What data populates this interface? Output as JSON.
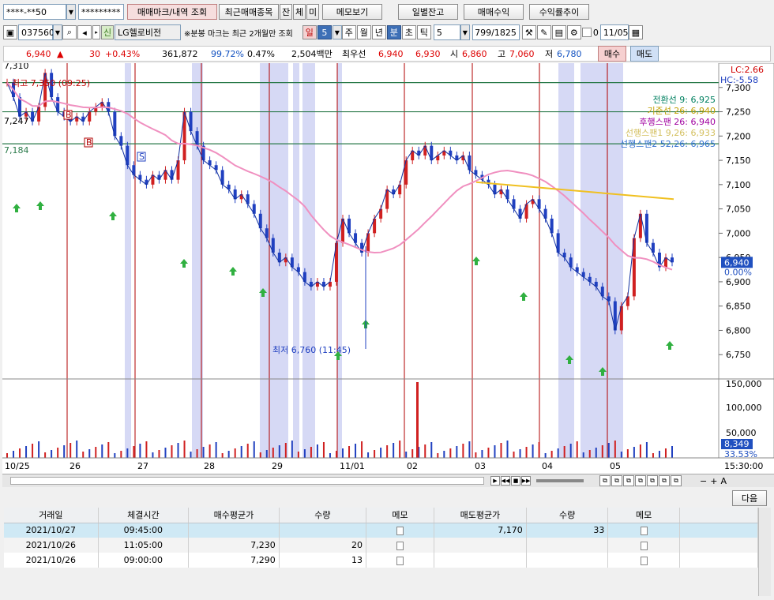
{
  "toolbar1": {
    "account_mask": "****-**50",
    "password_mask": "*********",
    "btn_trade_history": "매매마크/내역 조회",
    "btn_recent_items": "최근매매종목",
    "btn_jan": "잔",
    "btn_che": "체",
    "btn_mi": "미",
    "btn_memo": "메모보기",
    "btn_daily_balance": "일별잔고",
    "btn_trade_profit": "매매수익",
    "btn_return_trend": "수익률추이"
  },
  "toolbar2": {
    "code": "037560",
    "credit_badge": "신",
    "stock_name": "LG헬로비전",
    "notice": "※분봉 마크는 최근 2개월만 조회",
    "periods": [
      "일",
      "5",
      "주",
      "월",
      "년",
      "분",
      "초",
      "틱"
    ],
    "active_period": "분",
    "interval_value": "5",
    "count": "799/1825",
    "date_value": "11/05",
    "checkbox_label": "0"
  },
  "quote_bar": {
    "price": "6,940",
    "change": "30",
    "change_pct": "+0.43%",
    "volume": "361,872",
    "vol_ratio": "99.72%",
    "turnover": "0.47%",
    "amount": "2,504백만",
    "best_label": "최우선",
    "best_ask": "6,940",
    "best_bid": "6,930",
    "open_label": "시",
    "open": "6,860",
    "high_label": "고",
    "high": "7,060",
    "low_label": "저",
    "low": "6,780",
    "buy_btn": "매수",
    "sell_btn": "매도"
  },
  "chart_data": {
    "type": "line",
    "x_labels": [
      "10/25",
      "26",
      "27",
      "28",
      "29",
      "11/01",
      "02",
      "03",
      "04",
      "05"
    ],
    "y_ticks": [
      7300,
      7250,
      7200,
      7150,
      7100,
      7050,
      7000,
      6950,
      6900,
      6850,
      6800,
      6750
    ],
    "ylim": [
      6700,
      7350
    ],
    "vol_ticks": [
      "150,000",
      "100,000",
      "50,000"
    ],
    "current_price_label": "6,940",
    "current_pct_label": "0.00%",
    "current_vol_label": "8,349",
    "current_vol_pct_label": "33.53%",
    "lc_label": "LC:2.66",
    "hc_label": "HC:-5.58",
    "max_label": "최고 7,350 (09:25)",
    "min_label": "최저 6,760 (11:45)",
    "left_top_label": "7,310",
    "left_mid_label": "7,184",
    "left_mid2_label": "7,247",
    "time_label": "15:30:00",
    "ichimoku": [
      {
        "name": "전환선 9",
        "value": "6,925",
        "color": "#008060"
      },
      {
        "name": "기준선 26",
        "value": "6,940",
        "color": "#c0a000"
      },
      {
        "name": "후행스팬 26",
        "value": "6,940",
        "color": "#a000a0"
      },
      {
        "name": "선행스팬1 9,26",
        "value": "6,933",
        "color": "#d4c060"
      },
      {
        "name": "선행스팬2 52,26",
        "value": "6,965",
        "color": "#3070d0"
      }
    ],
    "price_series": [
      7310,
      7280,
      7240,
      7250,
      7230,
      7260,
      7330,
      7280,
      7250,
      7240,
      7230,
      7240,
      7230,
      7250,
      7260,
      7270,
      7250,
      7200,
      7180,
      7140,
      7120,
      7110,
      7100,
      7120,
      7110,
      7130,
      7110,
      7150,
      7250,
      7210,
      7180,
      7150,
      7140,
      7130,
      7100,
      7090,
      7070,
      7080,
      7060,
      7040,
      7010,
      6990,
      6960,
      6940,
      6950,
      6930,
      6920,
      6900,
      6890,
      6900,
      6890,
      6900,
      6980,
      7030,
      7000,
      6980,
      6960,
      7000,
      7030,
      7050,
      7090,
      7080,
      7100,
      7150,
      7170,
      7160,
      7180,
      7150,
      7160,
      7170,
      7160,
      7150,
      7160,
      7130,
      7120,
      7110,
      7100,
      7080,
      7090,
      7070,
      7050,
      7030,
      7060,
      7070,
      7050,
      7030,
      7000,
      6960,
      6950,
      6930,
      6920,
      6910,
      6900,
      6890,
      6870,
      6860,
      6800,
      6850,
      6870,
      6990,
      7040,
      6980,
      6960,
      6930,
      6950,
      6940
    ],
    "trade_marks": [
      {
        "type": "B",
        "label": "B"
      },
      {
        "type": "B",
        "label": "B"
      },
      {
        "type": "S",
        "label": "S"
      }
    ]
  },
  "chart_controls": {
    "time_label": "15:30:00",
    "minus": "−",
    "plus": "+",
    "font_a": "A"
  },
  "next_btn": "다음",
  "table": {
    "headers": [
      "거래일",
      "체결시간",
      "매수평균가",
      "수량",
      "메모",
      "매도평균가",
      "수량",
      "메모"
    ],
    "rows": [
      {
        "date": "2021/10/27",
        "time": "09:45:00",
        "buy_avg": "",
        "buy_qty": "",
        "sell_avg": "7,170",
        "sell_qty": "33"
      },
      {
        "date": "2021/10/26",
        "time": "11:05:00",
        "buy_avg": "7,230",
        "buy_qty": "20",
        "sell_avg": "",
        "sell_qty": ""
      },
      {
        "date": "2021/10/26",
        "time": "09:00:00",
        "buy_avg": "7,290",
        "buy_qty": "13",
        "sell_avg": "",
        "sell_qty": ""
      }
    ]
  }
}
